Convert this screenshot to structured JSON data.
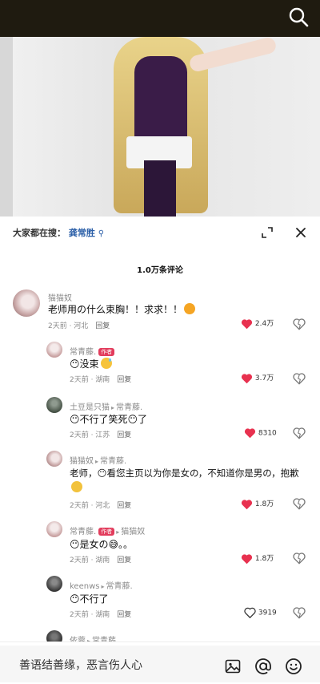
{
  "sheet": {
    "search_label": "大家都在搜：",
    "search_keyword": "龚常胜",
    "comment_count": "1.0万条评论"
  },
  "comments": [
    {
      "name": "猫猫奴",
      "text": "老师用の什么束胸！！求求！！",
      "emoji": "shout",
      "time": "2天前 · 河北",
      "reply": "回复",
      "likes": "2.4万",
      "liked": true
    },
    {
      "name": "常青藤.",
      "tag": "作者",
      "text": "😶没束",
      "emoji": "sweat",
      "time": "2天前 · 湖南",
      "reply": "回复",
      "likes": "3.7万",
      "liked": true
    },
    {
      "name": "土豆是只猫",
      "reply_to": "常青藤.",
      "text": "😶不行了笑死😶了",
      "time": "2天前 · 江苏",
      "reply": "回复",
      "likes": "8310",
      "liked": true
    },
    {
      "name": "猫猫奴",
      "reply_to": "常青藤.",
      "text": "老师，😶看您主页以为你是女の，不知道你是男の，抱歉",
      "emoji": "cry",
      "time": "2天前 · 河北",
      "reply": "回复",
      "likes": "1.8万",
      "liked": true
    },
    {
      "name": "常青藤.",
      "tag": "作者",
      "reply_to": "猫猫奴",
      "text": "😶是女の😅。。",
      "time": "2天前 · 湖南",
      "reply": "回复",
      "likes": "1.8万",
      "liked": true
    },
    {
      "name": "keenws",
      "reply_to": "常青藤.",
      "text": "😶不行了",
      "time": "2天前 · 湖南",
      "reply": "回复",
      "likes": "3919",
      "liked": false
    },
    {
      "name": "依蓉",
      "reply_to": "常青藤."
    }
  ],
  "input": {
    "placeholder": "善语结善缘，恶言伤人心"
  },
  "colors": {
    "like_red": "#e8314f",
    "keyword_blue": "#2b5fa8",
    "author_tag": "#e23c5c"
  },
  "icons": [
    "search-icon",
    "expand-icon",
    "close-icon",
    "heart-icon",
    "dislike-icon",
    "image-icon",
    "at-icon",
    "emoji-icon"
  ]
}
